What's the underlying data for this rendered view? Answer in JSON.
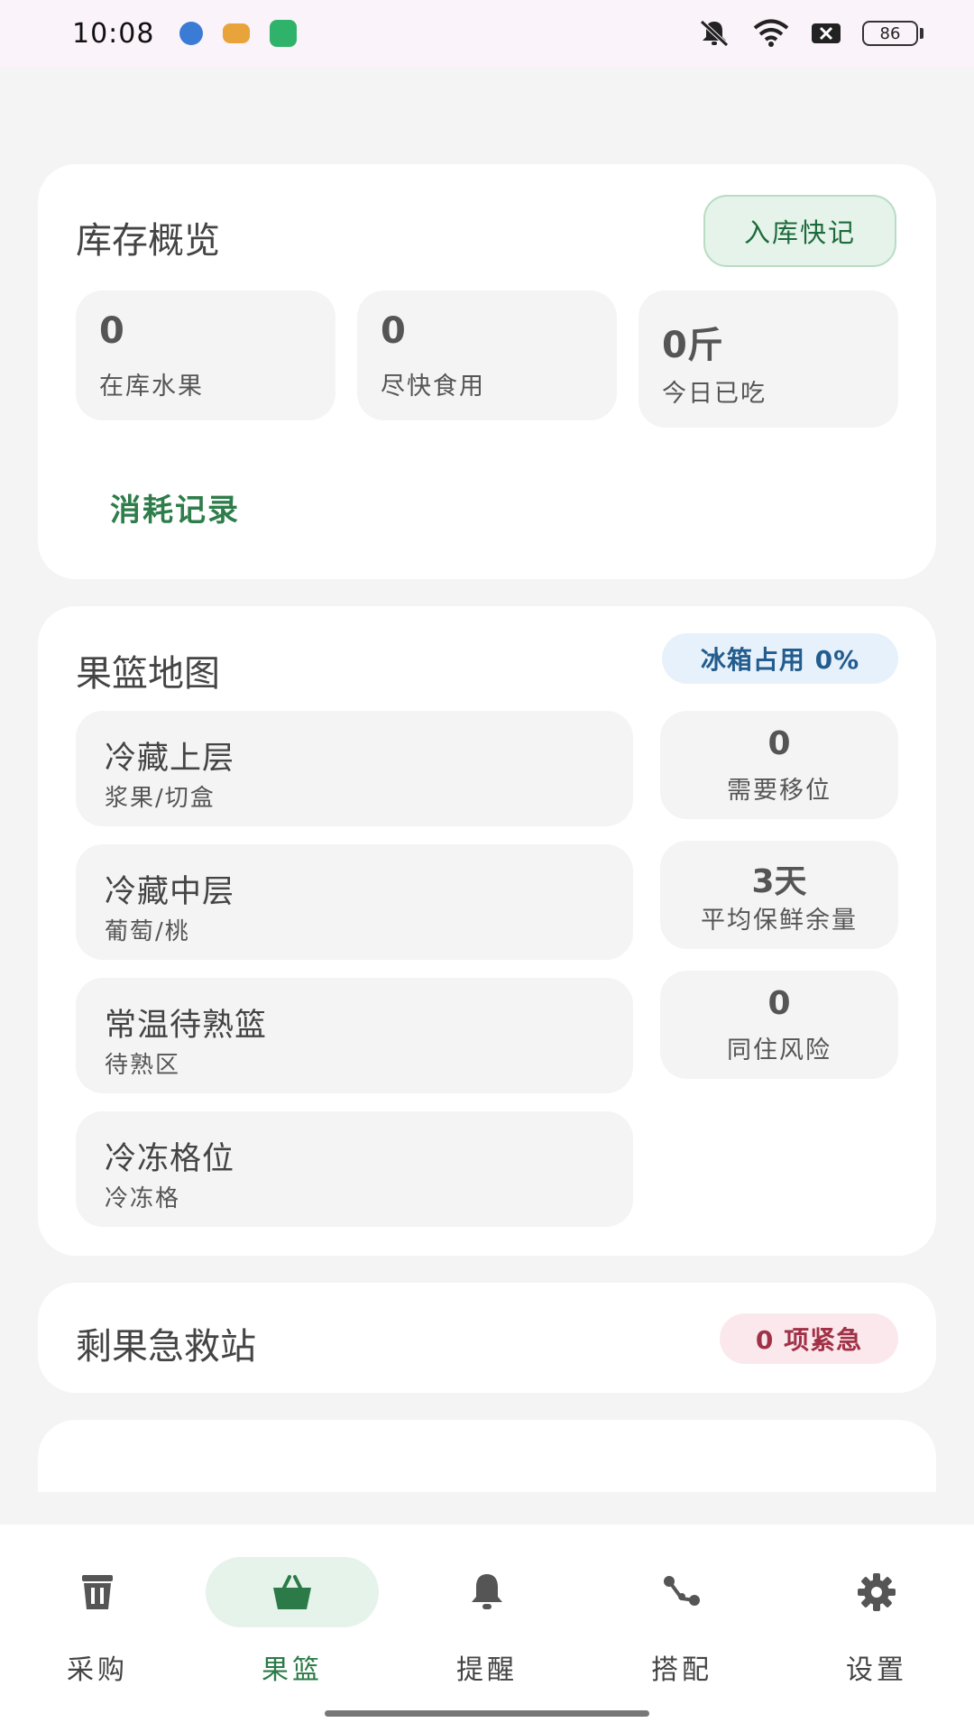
{
  "status": {
    "time": "10:08",
    "battery": "86",
    "app_colors": [
      "#3a7bd5",
      "#e8a33b",
      "#2fb36a"
    ],
    "icons": [
      "mute-icon",
      "wifi-icon",
      "sim-off-icon",
      "battery-icon"
    ]
  },
  "inventory": {
    "title": "库存概览",
    "quick_entry": "入库快记",
    "stats": [
      {
        "value": "0",
        "label": "在库水果"
      },
      {
        "value": "0",
        "label": "尽快食用"
      },
      {
        "value": "0斤",
        "label": "今日已吃"
      }
    ],
    "log_link": "消耗记录"
  },
  "basket_map": {
    "title": "果篮地图",
    "fridge_badge": "冰箱占用 0%",
    "zones": [
      {
        "name": "冷藏上层",
        "sub": "浆果/切盒"
      },
      {
        "name": "冷藏中层",
        "sub": "葡萄/桃"
      },
      {
        "name": "常温待熟篮",
        "sub": "待熟区"
      },
      {
        "name": "冷冻格位",
        "sub": "冷冻格"
      }
    ],
    "metrics": [
      {
        "value": "0",
        "label": "需要移位"
      },
      {
        "value": "3天",
        "label": "平均保鲜余量"
      },
      {
        "value": "0",
        "label": "同住风险"
      }
    ]
  },
  "rescue": {
    "title": "剩果急救站",
    "badge": "0 项紧急"
  },
  "nav": {
    "active_color": "#2b7a48",
    "items": [
      {
        "label": "采购",
        "icon": "trash-bin-icon"
      },
      {
        "label": "果篮",
        "icon": "basket-icon"
      },
      {
        "label": "提醒",
        "icon": "bell-icon"
      },
      {
        "label": "搭配",
        "icon": "connect-icon"
      },
      {
        "label": "设置",
        "icon": "gear-icon"
      }
    ]
  }
}
